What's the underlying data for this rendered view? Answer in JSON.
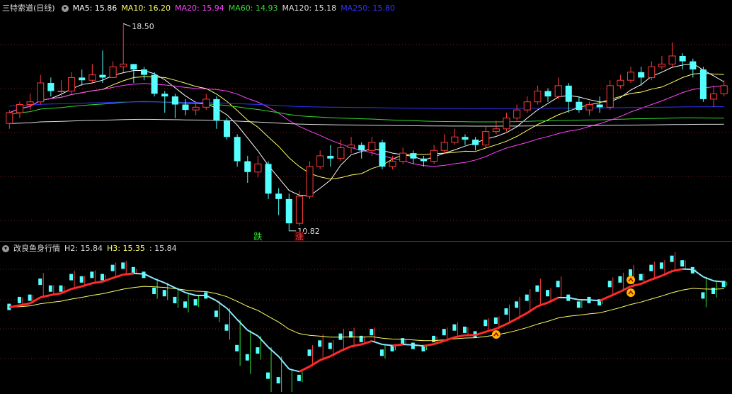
{
  "main": {
    "title": "三特索道(日线)",
    "indicators": [
      {
        "label": "MA5: 15.86",
        "color": "#ffffff"
      },
      {
        "label": "MA10: 16.20",
        "color": "#ffff66"
      },
      {
        "label": "MA20: 15.94",
        "color": "#ff44ff"
      },
      {
        "label": "MA60: 14.93",
        "color": "#33dd33"
      },
      {
        "label": "MA120: 15.18",
        "color": "#dddddd"
      },
      {
        "label": "MA250: 15.80",
        "color": "#3333ff"
      }
    ],
    "high_label": "18.50",
    "low_label": "10.82",
    "signal_fall": "跌",
    "signal_rise": "涨"
  },
  "sub": {
    "title": "改良鱼身行情",
    "indicators": [
      {
        "label": "H2: 15.84",
        "color": "#dddddd"
      },
      {
        "label": "H3: 15.35",
        "color": "#ffff66"
      },
      {
        "label": ": 15.84",
        "color": "#dddddd"
      }
    ]
  },
  "chart_data": [
    {
      "type": "candlestick",
      "title": "三特索道(日线)",
      "series_names": [
        "MA5",
        "MA10",
        "MA20",
        "MA60",
        "MA120",
        "MA250"
      ],
      "ylim": [
        10.5,
        18.9
      ],
      "candles": [
        [
          14.8,
          15.2,
          15.3,
          14.6
        ],
        [
          15.2,
          15.5,
          15.6,
          15.0
        ],
        [
          15.5,
          15.6,
          15.9,
          15.3
        ],
        [
          15.6,
          16.3,
          16.6,
          15.5
        ],
        [
          16.3,
          16.0,
          16.5,
          15.8
        ],
        [
          16.0,
          16.0,
          16.4,
          15.8
        ],
        [
          16.0,
          16.5,
          16.7,
          15.9
        ],
        [
          16.5,
          16.4,
          16.8,
          16.2
        ],
        [
          16.4,
          16.6,
          17.0,
          16.3
        ],
        [
          16.6,
          16.5,
          17.5,
          16.3
        ],
        [
          16.5,
          16.9,
          17.1,
          16.5
        ],
        [
          16.9,
          17.0,
          18.5,
          16.7
        ],
        [
          17.0,
          16.8,
          17.0,
          16.3
        ],
        [
          16.8,
          16.6,
          16.9,
          16.4
        ],
        [
          16.6,
          15.9,
          16.7,
          15.8
        ],
        [
          15.9,
          15.8,
          16.0,
          15.2
        ],
        [
          15.8,
          15.5,
          15.9,
          15.0
        ],
        [
          15.5,
          15.3,
          15.7,
          15.1
        ],
        [
          15.3,
          15.4,
          15.6,
          15.1
        ],
        [
          15.4,
          15.7,
          15.9,
          15.3
        ],
        [
          15.7,
          14.9,
          15.8,
          14.6
        ],
        [
          14.9,
          14.3,
          15.0,
          14.2
        ],
        [
          14.3,
          13.4,
          14.4,
          13.2
        ],
        [
          13.4,
          13.0,
          13.6,
          12.6
        ],
        [
          13.0,
          13.3,
          13.6,
          12.8
        ],
        [
          13.3,
          12.2,
          13.4,
          12.0
        ],
        [
          12.2,
          12.0,
          12.4,
          11.4
        ],
        [
          12.0,
          11.1,
          12.2,
          10.82
        ],
        [
          11.1,
          12.1,
          12.3,
          11.0
        ],
        [
          12.1,
          13.2,
          13.4,
          12.0
        ],
        [
          13.2,
          13.6,
          13.8,
          13.1
        ],
        [
          13.6,
          13.5,
          14.0,
          13.2
        ],
        [
          13.5,
          13.9,
          14.2,
          13.4
        ],
        [
          13.9,
          14.0,
          14.3,
          13.7
        ],
        [
          14.0,
          13.8,
          14.1,
          13.5
        ],
        [
          13.8,
          14.1,
          14.3,
          13.6
        ],
        [
          14.1,
          13.2,
          14.2,
          13.1
        ],
        [
          13.2,
          13.4,
          13.6,
          13.1
        ],
        [
          13.4,
          13.7,
          13.9,
          13.3
        ],
        [
          13.7,
          13.5,
          13.8,
          13.3
        ],
        [
          13.5,
          13.4,
          13.6,
          13.2
        ],
        [
          13.4,
          13.8,
          14.0,
          13.3
        ],
        [
          13.8,
          14.1,
          14.4,
          13.7
        ],
        [
          14.1,
          14.3,
          14.6,
          14.0
        ],
        [
          14.3,
          14.2,
          14.4,
          14.0
        ],
        [
          14.2,
          14.0,
          14.3,
          13.8
        ],
        [
          14.0,
          14.5,
          14.7,
          13.9
        ],
        [
          14.5,
          14.6,
          14.9,
          14.4
        ],
        [
          14.6,
          15.0,
          15.2,
          14.5
        ],
        [
          15.0,
          15.3,
          15.5,
          14.9
        ],
        [
          15.3,
          15.6,
          15.8,
          15.2
        ],
        [
          15.6,
          16.0,
          16.2,
          15.5
        ],
        [
          16.0,
          15.8,
          16.1,
          15.6
        ],
        [
          15.8,
          16.2,
          16.5,
          15.7
        ],
        [
          16.2,
          15.6,
          16.3,
          15.2
        ],
        [
          15.6,
          15.3,
          15.8,
          15.2
        ],
        [
          15.3,
          15.5,
          15.6,
          15.1
        ],
        [
          15.5,
          15.4,
          15.8,
          15.2
        ],
        [
          15.4,
          16.2,
          16.4,
          15.3
        ],
        [
          16.2,
          16.4,
          16.6,
          16.1
        ],
        [
          16.4,
          16.7,
          16.9,
          16.3
        ],
        [
          16.7,
          16.5,
          16.9,
          16.2
        ],
        [
          16.5,
          16.9,
          17.1,
          16.4
        ],
        [
          16.9,
          17.0,
          17.3,
          16.8
        ],
        [
          17.0,
          17.3,
          17.8,
          16.9
        ],
        [
          17.3,
          17.1,
          17.4,
          16.8
        ],
        [
          17.1,
          16.8,
          17.2,
          16.5
        ],
        [
          16.8,
          15.7,
          16.9,
          15.6
        ],
        [
          15.7,
          15.9,
          16.2,
          15.4
        ],
        [
          15.9,
          16.2,
          16.4,
          15.8
        ]
      ]
    },
    {
      "type": "line",
      "title": "改良鱼身行情",
      "series_names": [
        "H2",
        "H3"
      ],
      "latest": {
        "H2": 15.84,
        "H3": 15.35
      },
      "signals": [
        "up",
        "up",
        "up"
      ]
    }
  ]
}
